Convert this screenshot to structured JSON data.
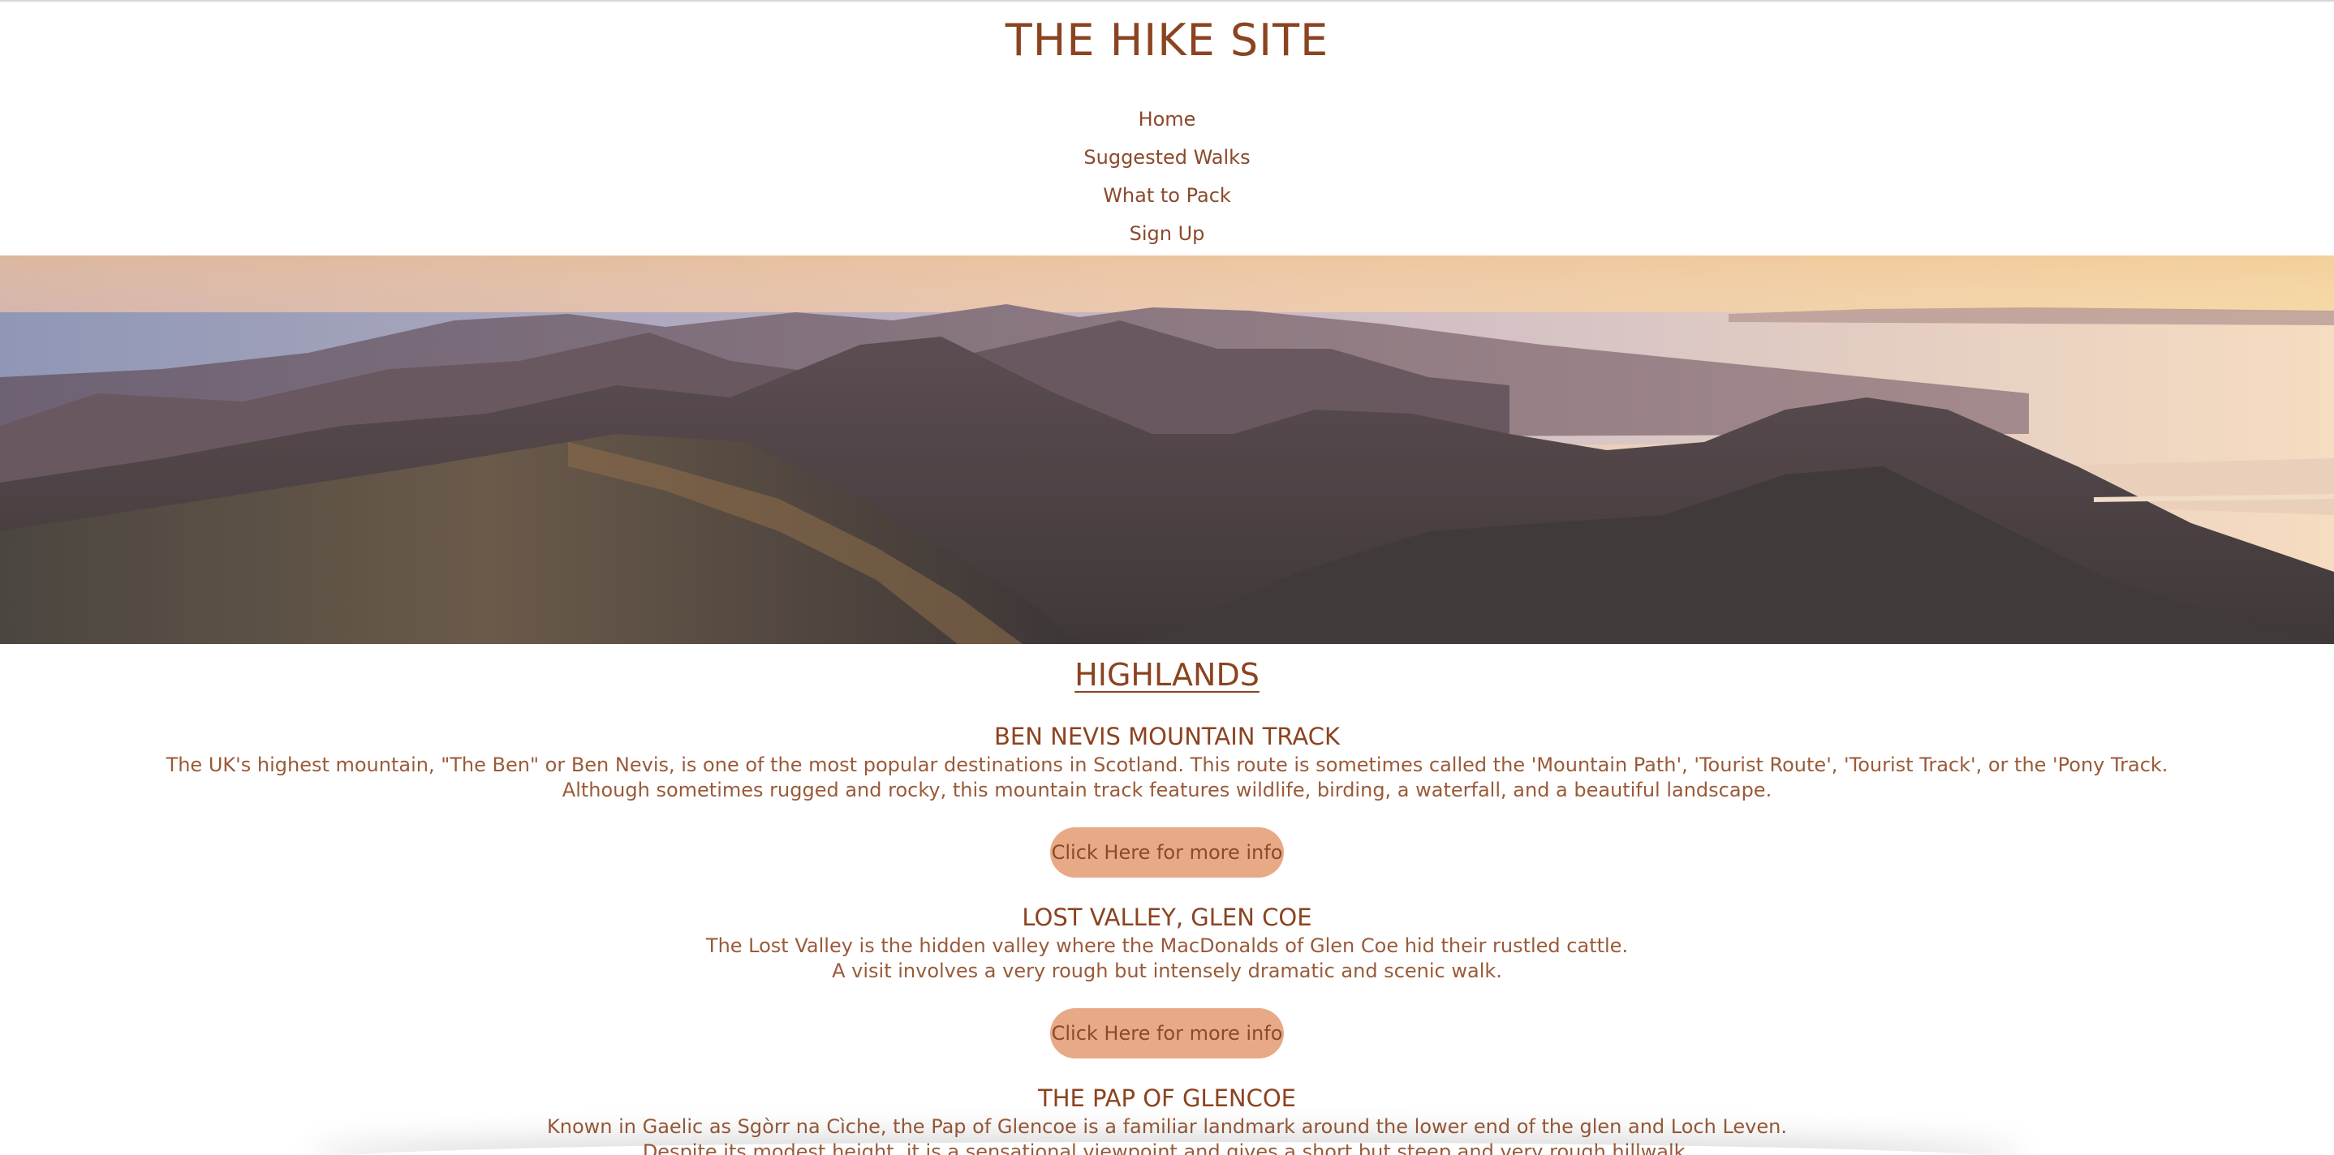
{
  "site": {
    "title": "THE HIKE SITE"
  },
  "nav": {
    "items": [
      {
        "label": "Home"
      },
      {
        "label": "Suggested Walks"
      },
      {
        "label": "What to Pack"
      },
      {
        "label": "Sign Up"
      }
    ]
  },
  "hero": {
    "icon": "mountain-landscape-photo"
  },
  "region": {
    "heading": "HIGHLANDS"
  },
  "walks": [
    {
      "title": "BEN NEVIS MOUNTAIN TRACK",
      "lines": [
        "The UK's highest mountain, \"The Ben\" or Ben Nevis, is one of the most popular destinations in Scotland. This route is sometimes called the 'Mountain Path', 'Tourist Route', 'Tourist Track', or the 'Pony Track.",
        "Although sometimes rugged and rocky, this mountain track features wildlife, birding, a waterfall, and a beautiful landscape."
      ],
      "button": "Click Here for more info"
    },
    {
      "title": "LOST VALLEY, GLEN COE",
      "lines": [
        "The Lost Valley is the hidden valley where the MacDonalds of Glen Coe hid their rustled cattle.",
        "A visit involves a very rough but intensely dramatic and scenic walk."
      ],
      "button": "Click Here for more info"
    },
    {
      "title": "THE PAP OF GLENCOE",
      "lines": [
        "Known in Gaelic as Sgòrr na Cìche, the Pap of Glencoe is a familiar landmark around the lower end of the glen and Loch Leven.",
        "Despite its modest height, it is a sensational viewpoint and gives a short but steep and very rough hillwalk."
      ]
    }
  ],
  "colors": {
    "title": "#8b4320",
    "text": "#9a5a38",
    "button_bg": "#e8a986"
  }
}
